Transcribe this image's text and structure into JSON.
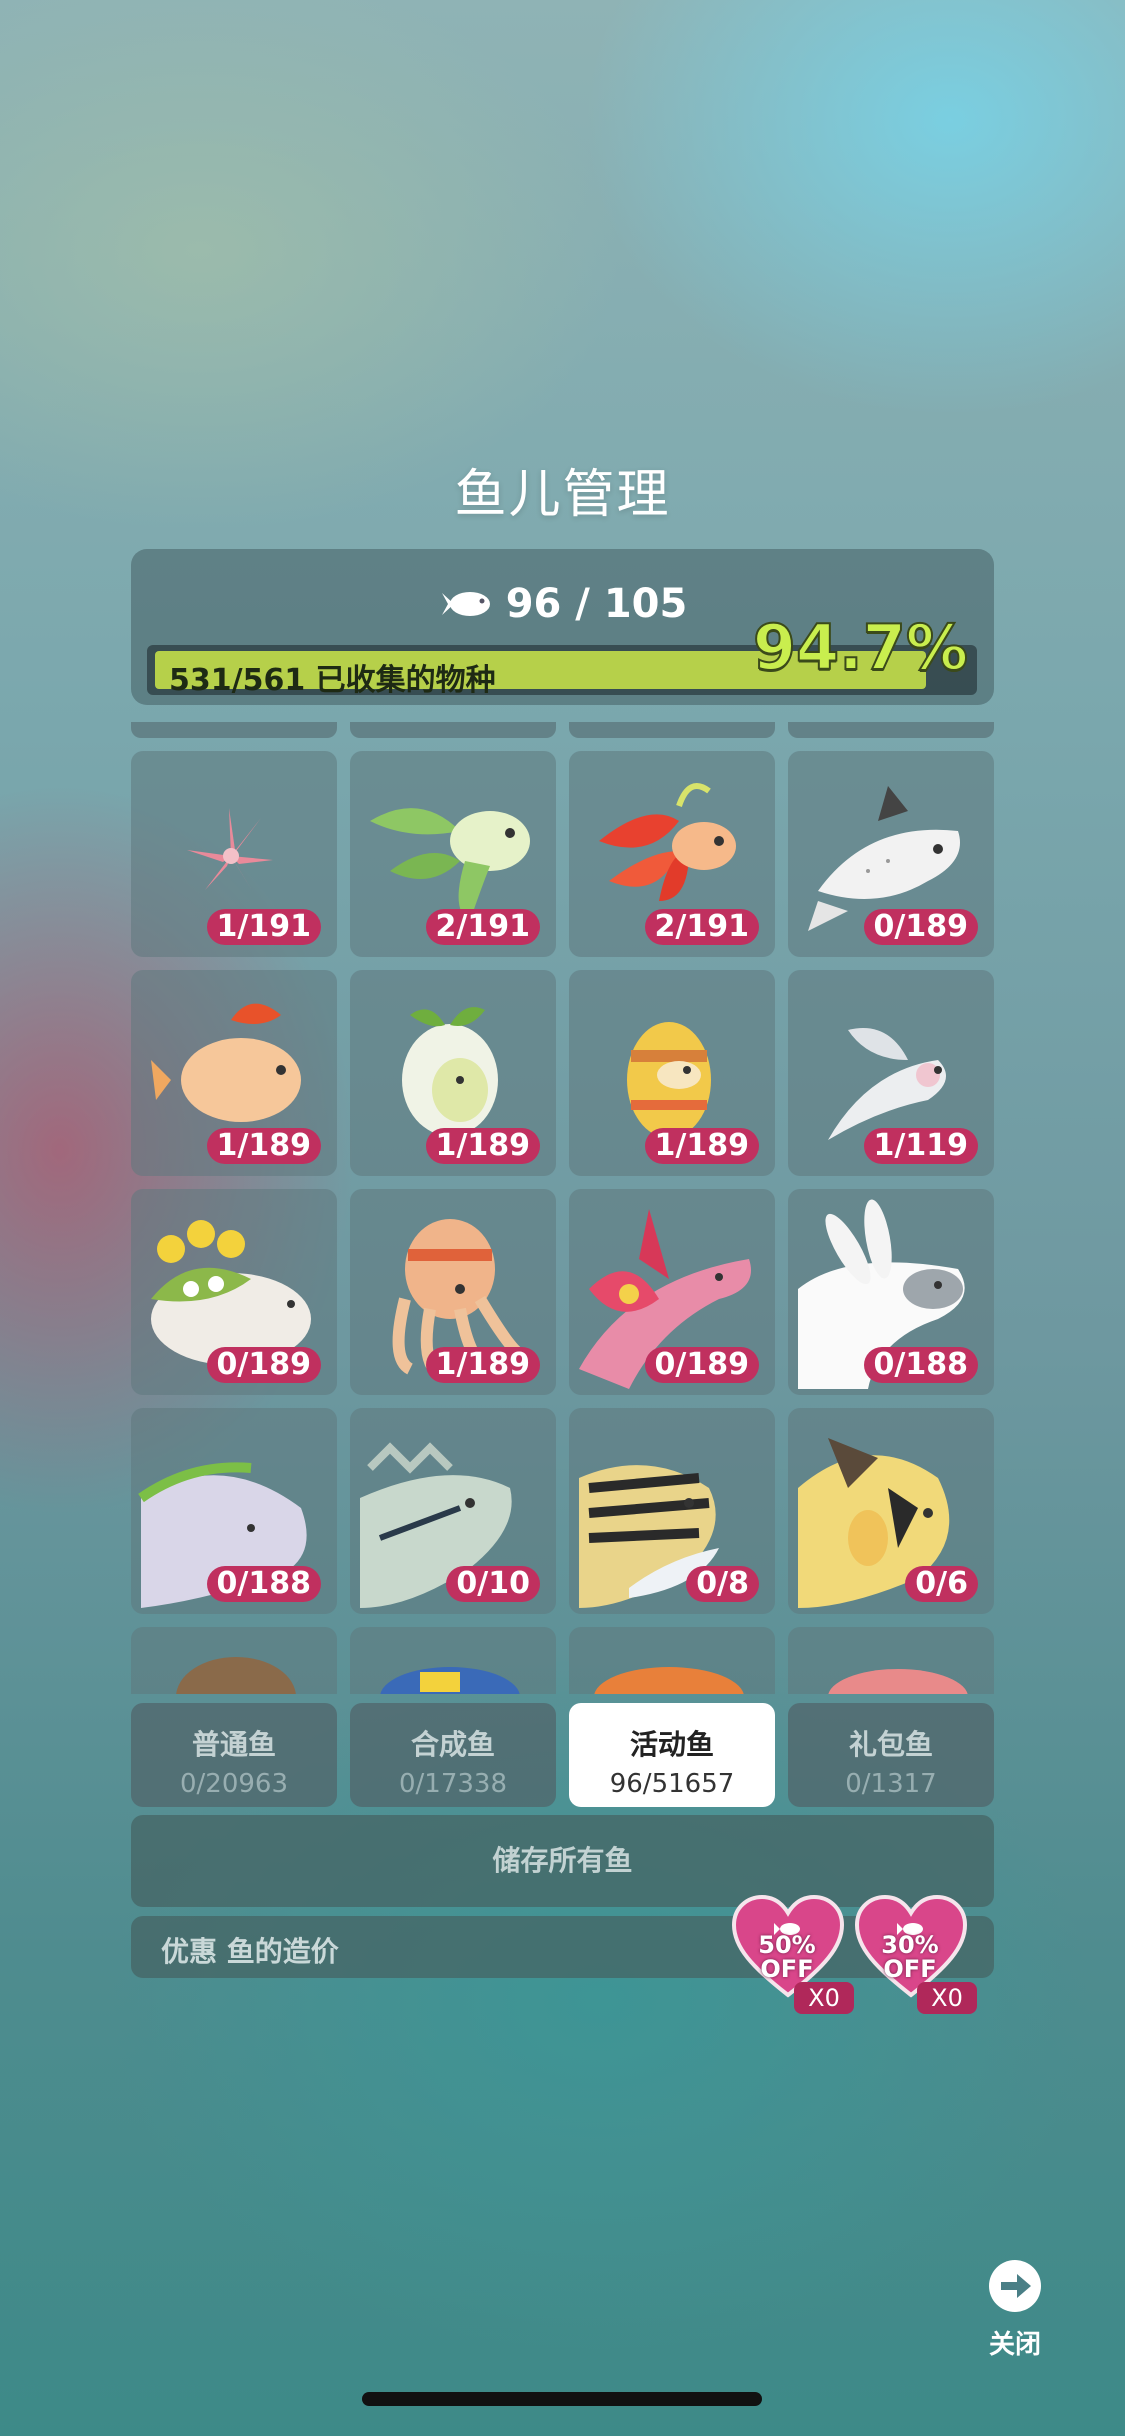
{
  "title": "鱼儿管理",
  "header": {
    "fish_count": "96 / 105",
    "collected_text": "531/561 已收集的物种",
    "percent_text": "94.7%",
    "progress": 0.947
  },
  "tiles": [
    {
      "count": "1/191",
      "icon": "pink-sea-anemone-icon"
    },
    {
      "count": "2/191",
      "icon": "leaf-fish-icon"
    },
    {
      "count": "2/191",
      "icon": "red-flower-fish-icon"
    },
    {
      "count": "0/189",
      "icon": "white-spotted-fish-icon"
    },
    {
      "count": "1/189",
      "icon": "orange-mushroom-fish-icon"
    },
    {
      "count": "1/189",
      "icon": "sprout-fish-icon"
    },
    {
      "count": "1/189",
      "icon": "easter-egg-fish-icon"
    },
    {
      "count": "1/119",
      "icon": "white-flying-fish-icon"
    },
    {
      "count": "0/189",
      "icon": "flower-turtle-icon"
    },
    {
      "count": "1/189",
      "icon": "egg-octopus-icon"
    },
    {
      "count": "0/189",
      "icon": "flower-dolphin-icon"
    },
    {
      "count": "0/188",
      "icon": "bunny-fish-icon"
    },
    {
      "count": "0/188",
      "icon": "whale-icon"
    },
    {
      "count": "0/10",
      "icon": "striped-perch-icon"
    },
    {
      "count": "0/8",
      "icon": "tiger-striped-fish-icon"
    },
    {
      "count": "0/6",
      "icon": "yellow-triggerfish-icon"
    }
  ],
  "tabs": [
    {
      "label": "普通鱼",
      "count": "0/20963"
    },
    {
      "label": "合成鱼",
      "count": "0/17338"
    },
    {
      "label": "活动鱼",
      "count": "96/51657"
    },
    {
      "label": "礼包鱼",
      "count": "0/1317"
    }
  ],
  "store_all_label": "储存所有鱼",
  "discount": {
    "label": "优惠 鱼的造价",
    "coupons": [
      {
        "pct": "50%",
        "off": "OFF",
        "qty": "X0"
      },
      {
        "pct": "30%",
        "off": "OFF",
        "qty": "X0"
      }
    ]
  },
  "close_label": "关闭",
  "colors": {
    "badge": "#c0305f",
    "progress": "#b6d04a",
    "percent": "#c9ee4e",
    "coupon": "#d9468a"
  }
}
